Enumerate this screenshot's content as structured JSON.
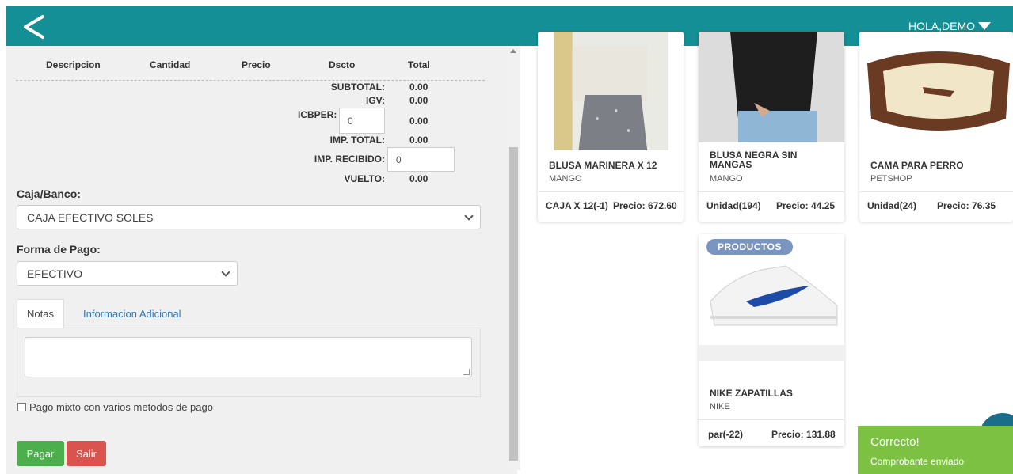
{
  "header": {
    "user_label": "HOLA,DEMO",
    "accent_color": "#138f95",
    "back_icon": "chevron-left-icon"
  },
  "order_table": {
    "columns": [
      "Descripcion",
      "Cantidad",
      "Precio",
      "Dscto",
      "Total"
    ]
  },
  "totals": {
    "subtotal_label": "SUBTOTAL:",
    "subtotal_value": "0.00",
    "igv_label": "IGV:",
    "igv_value": "0.00",
    "icbper_label": "ICBPER:",
    "icbper_input": "0",
    "icbper_value": "0.00",
    "imp_total_label": "IMP. TOTAL:",
    "imp_total_value": "0.00",
    "imp_recibido_label": "IMP. RECIBIDO:",
    "imp_recibido_input": "0",
    "vuelto_label": "VUELTO:",
    "vuelto_value": "0.00"
  },
  "form": {
    "caja_label": "Caja/Banco:",
    "caja_value": "CAJA EFECTIVO SOLES",
    "forma_label": "Forma de Pago:",
    "forma_value": "EFECTIVO",
    "tabs": [
      {
        "label": "Notas",
        "active": true
      },
      {
        "label": "Informacion Adicional",
        "active": false
      }
    ],
    "checkbox_label": "Pago mixto con varios metodos de pago",
    "pay_button": "Pagar",
    "exit_button": "Salir"
  },
  "products": [
    {
      "title": "BLUSA MARINERA X 12",
      "brand": "MANGO",
      "unit": "CAJA X 12(-1)",
      "price": "Precio: 672.60"
    },
    {
      "title": "BLUSA NEGRA SIN MANGAS",
      "brand": "MANGO",
      "unit": "Unidad(194)",
      "price": "Precio: 44.25"
    },
    {
      "title": "CAMA PARA PERRO",
      "brand": "PETSHOP",
      "unit": "Unidad(24)",
      "price": "Precio: 76.35"
    },
    {
      "title": "NIKE ZAPATILLAS",
      "brand": "NIKE",
      "unit": "par(-22)",
      "price": "Precio: 131.88",
      "badge": "PRODUCTOS"
    }
  ],
  "toast": {
    "title": "Correcto!",
    "message": "Comprobante enviado"
  }
}
